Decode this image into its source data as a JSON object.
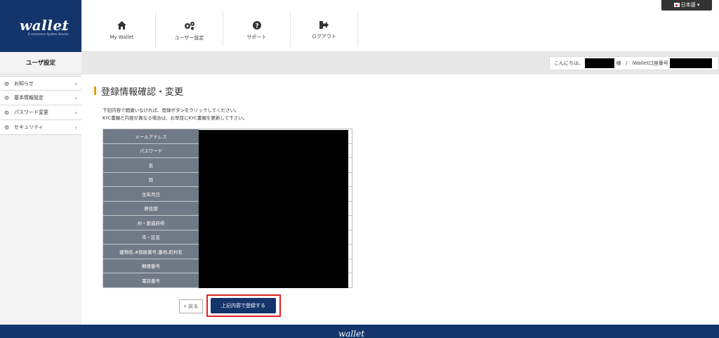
{
  "brand": {
    "logo_text": "wallet",
    "tagline": "E-commerce System Service"
  },
  "language": {
    "label": "日本語 ▾"
  },
  "nav": [
    {
      "label": "My Wallet",
      "icon": "home-icon"
    },
    {
      "label": "ユーザー設定",
      "icon": "gears-icon"
    },
    {
      "label": "サポート",
      "icon": "question-icon"
    },
    {
      "label": "ログアウト",
      "icon": "logout-icon"
    }
  ],
  "sidebar": {
    "title": "ユーザ設定",
    "items": [
      {
        "label": "お知らせ"
      },
      {
        "label": "基本情報設定"
      },
      {
        "label": "パスワード変更"
      },
      {
        "label": "セキュリティ"
      }
    ]
  },
  "greeting": {
    "prefix": "こんにちは、",
    "honorific": "様",
    "separator": "/",
    "account_label": "iWallet口座番号"
  },
  "main": {
    "title": "登録情報確認・変更",
    "desc_line1": "下記内容で間違いなければ、登録ボタンをクリックしてください。",
    "desc_line2": "KYC書類と内容が異なる場合は、お早目にKYC書類を更新して下さい。",
    "fields": [
      "メールアドレス",
      "パスワード",
      "名",
      "姓",
      "生年月日",
      "居住国",
      "州・都道府県",
      "市・区名",
      "建物名,#部屋番号,番地,町村名",
      "郵便番号",
      "電話番号"
    ],
    "back_label": "« 戻る",
    "submit_label": "上記内容で登録する"
  },
  "footer": {
    "logo_text": "wallet"
  },
  "colors": {
    "brand": "#14356b",
    "accent": "#e0a000",
    "highlight": "#e02020",
    "table_header": "#707a86"
  }
}
